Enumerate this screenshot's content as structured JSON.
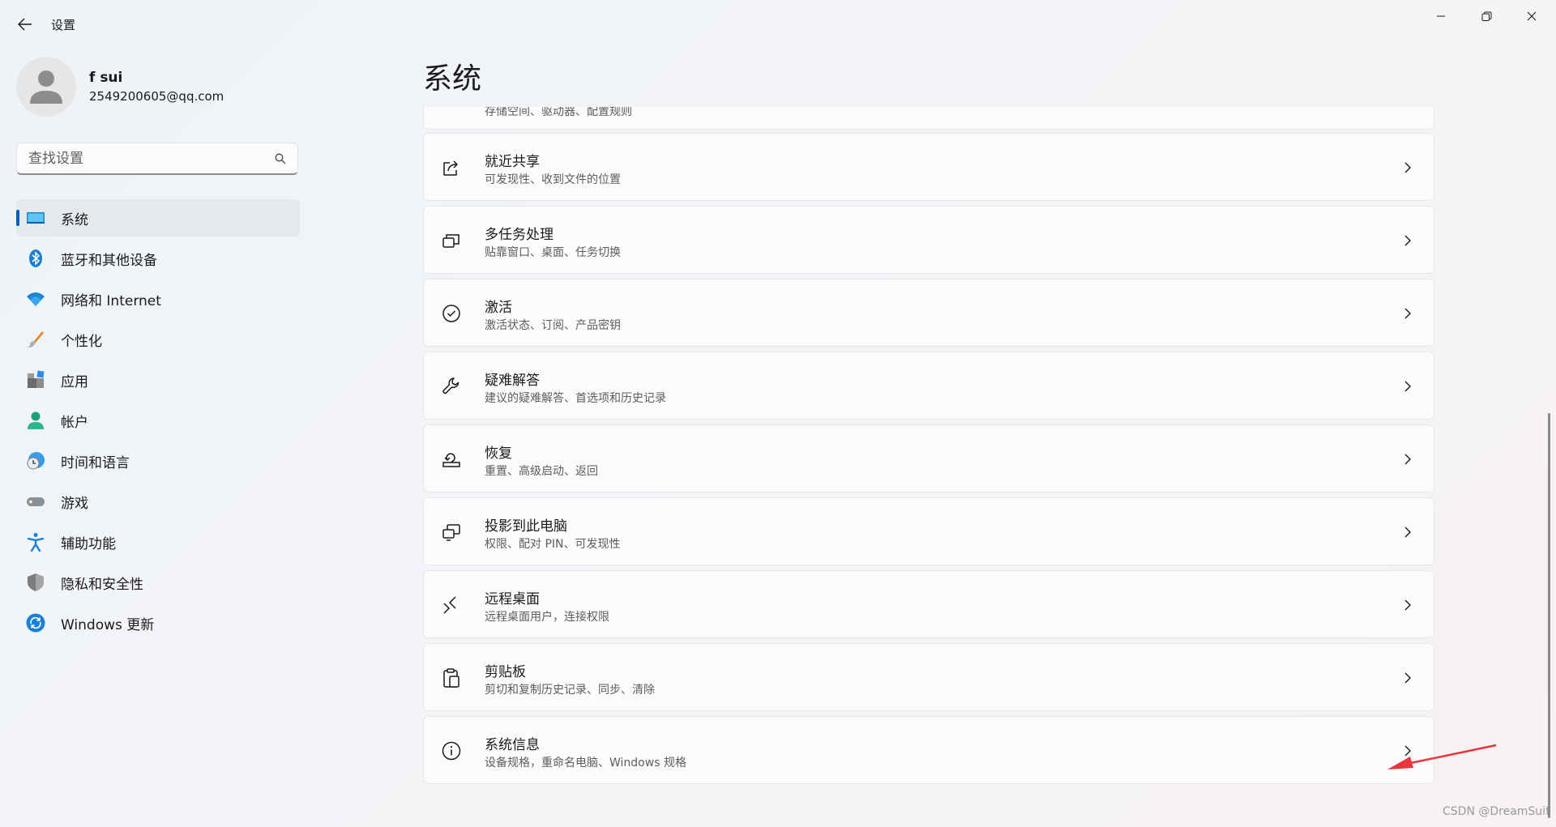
{
  "window": {
    "title": "设置",
    "controls": [
      "minimize-icon",
      "maximize-icon",
      "close-icon"
    ]
  },
  "profile": {
    "name": "f sui",
    "email": "2549200605@qq.com"
  },
  "search": {
    "placeholder": "查找设置"
  },
  "nav": {
    "items": [
      {
        "label": "系统",
        "icon": "system-icon",
        "active": true
      },
      {
        "label": "蓝牙和其他设备",
        "icon": "bluetooth-icon"
      },
      {
        "label": "网络和 Internet",
        "icon": "wifi-icon"
      },
      {
        "label": "个性化",
        "icon": "brush-icon"
      },
      {
        "label": "应用",
        "icon": "apps-icon"
      },
      {
        "label": "帐户",
        "icon": "account-icon"
      },
      {
        "label": "时间和语言",
        "icon": "time-language-icon"
      },
      {
        "label": "游戏",
        "icon": "gamepad-icon"
      },
      {
        "label": "辅助功能",
        "icon": "accessibility-icon"
      },
      {
        "label": "隐私和安全性",
        "icon": "shield-icon"
      },
      {
        "label": "Windows 更新",
        "icon": "update-icon"
      }
    ]
  },
  "main": {
    "title": "系统",
    "partial_card": {
      "subtitle": "存储空间、驱动器、配置规则"
    },
    "cards": [
      {
        "title": "就近共享",
        "subtitle": "可发现性、收到文件的位置",
        "icon": "share-icon"
      },
      {
        "title": "多任务处理",
        "subtitle": "贴靠窗口、桌面、任务切换",
        "icon": "multitask-icon"
      },
      {
        "title": "激活",
        "subtitle": "激活状态、订阅、产品密钥",
        "icon": "check-circle-icon"
      },
      {
        "title": "疑难解答",
        "subtitle": "建议的疑难解答、首选项和历史记录",
        "icon": "wrench-icon"
      },
      {
        "title": "恢复",
        "subtitle": "重置、高级启动、返回",
        "icon": "recovery-icon"
      },
      {
        "title": "投影到此电脑",
        "subtitle": "权限、配对 PIN、可发现性",
        "icon": "project-icon"
      },
      {
        "title": "远程桌面",
        "subtitle": "远程桌面用户，连接权限",
        "icon": "remote-desktop-icon"
      },
      {
        "title": "剪贴板",
        "subtitle": "剪切和复制历史记录、同步、清除",
        "icon": "clipboard-icon"
      },
      {
        "title": "系统信息",
        "subtitle": "设备规格，重命名电脑、Windows 规格",
        "icon": "info-icon"
      }
    ]
  },
  "watermark": "CSDN @DreamSuif",
  "colors": {
    "accent": "#005fb8",
    "annotation": "#e8343a"
  }
}
